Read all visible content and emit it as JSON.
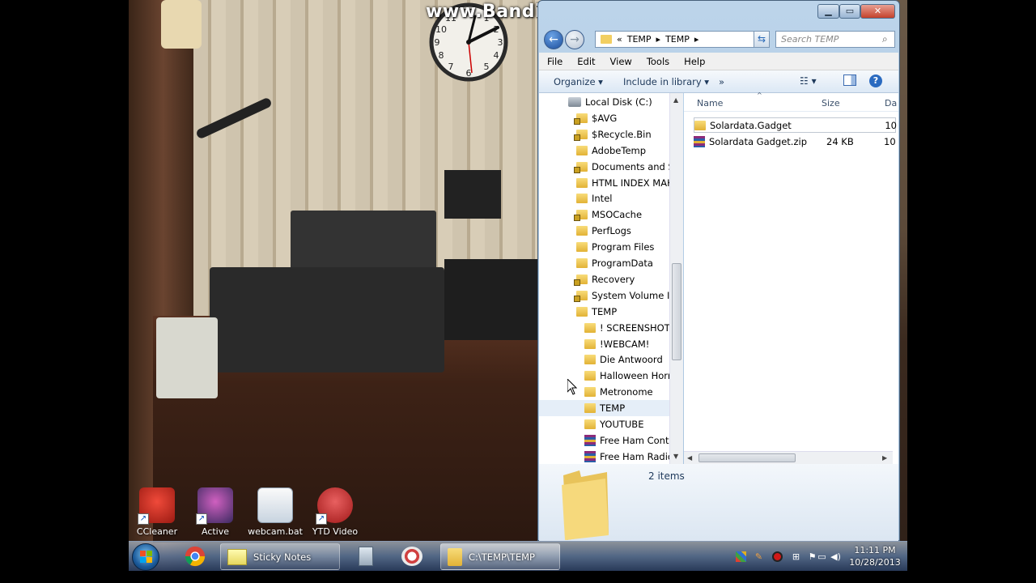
{
  "watermark": "www.Bandicam.com",
  "explorer": {
    "address_parts": [
      "«",
      "TEMP",
      "▸",
      "TEMP",
      "▸"
    ],
    "search_placeholder": "Search TEMP",
    "menu": [
      "File",
      "Edit",
      "View",
      "Tools",
      "Help"
    ],
    "toolbar": {
      "organize": "Organize ▾",
      "include": "Include in library ▾",
      "more": "»"
    },
    "tree": [
      {
        "label": "Local Disk (C:)",
        "kind": "disk"
      },
      {
        "label": "$AVG",
        "kind": "locked"
      },
      {
        "label": "$Recycle.Bin",
        "kind": "locked"
      },
      {
        "label": "AdobeTemp",
        "kind": "folder"
      },
      {
        "label": "Documents and Se",
        "kind": "locked"
      },
      {
        "label": "HTML INDEX MAK",
        "kind": "folder"
      },
      {
        "label": "Intel",
        "kind": "folder"
      },
      {
        "label": "MSOCache",
        "kind": "locked"
      },
      {
        "label": "PerfLogs",
        "kind": "folder"
      },
      {
        "label": "Program Files",
        "kind": "folder"
      },
      {
        "label": "ProgramData",
        "kind": "folder"
      },
      {
        "label": "Recovery",
        "kind": "locked"
      },
      {
        "label": "System Volume Inf",
        "kind": "locked"
      },
      {
        "label": "TEMP",
        "kind": "folder"
      },
      {
        "label": "! SCREENSHOTS",
        "kind": "folder"
      },
      {
        "label": "!WEBCAM!",
        "kind": "folder"
      },
      {
        "label": "Die Antwoord",
        "kind": "folder"
      },
      {
        "label": "Halloween Horro",
        "kind": "folder"
      },
      {
        "label": "Metronome",
        "kind": "folder"
      },
      {
        "label": "TEMP",
        "kind": "folder"
      },
      {
        "label": "YOUTUBE",
        "kind": "folder"
      },
      {
        "label": "Free Ham Conta",
        "kind": "zip"
      },
      {
        "label": "Free Ham Radio",
        "kind": "zip"
      }
    ],
    "columns": {
      "name": "Name",
      "size": "Size",
      "date": "Da"
    },
    "files": [
      {
        "name": "Solardata.Gadget",
        "size": "",
        "date": "10",
        "kind": "folder"
      },
      {
        "name": "Solardata Gadget.zip",
        "size": "24 KB",
        "date": "10",
        "kind": "zip"
      }
    ],
    "item_count": "2 items"
  },
  "desktop_icons": [
    {
      "label": "CCleaner"
    },
    {
      "label": "Active"
    },
    {
      "label": "webcam.bat"
    },
    {
      "label": "YTD Video"
    }
  ],
  "taskbar": {
    "sticky_notes": "Sticky Notes",
    "explorer_task": "C:\\TEMP\\TEMP",
    "time": "11:11 PM",
    "date": "10/28/2013"
  }
}
